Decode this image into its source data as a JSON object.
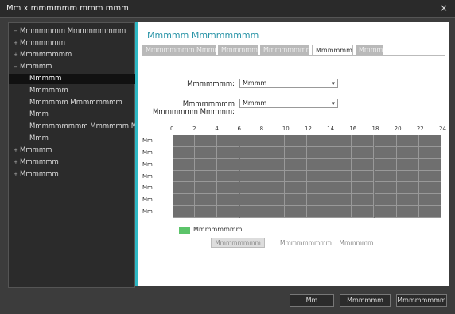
{
  "window": {
    "title": "Mm x mmmmmm mmm mmm",
    "close_glyph": "×"
  },
  "sidebar": {
    "items": [
      {
        "label": "Mmmmmmm Mmmmmmmmm",
        "level": 0,
        "exp": "−",
        "sel": false
      },
      {
        "label": "Mmmmmmm",
        "level": 0,
        "exp": "+",
        "sel": false
      },
      {
        "label": "Mmmmmmmm",
        "level": 0,
        "exp": "+",
        "sel": false
      },
      {
        "label": "Mmmmm",
        "level": 0,
        "exp": "−",
        "sel": false
      },
      {
        "label": "Mmmmm",
        "level": 1,
        "exp": "",
        "sel": true
      },
      {
        "label": "Mmmmmm",
        "level": 1,
        "exp": "",
        "sel": false
      },
      {
        "label": "Mmmmmm Mmmmmmmm",
        "level": 1,
        "exp": "",
        "sel": false
      },
      {
        "label": "Mmm",
        "level": 1,
        "exp": "",
        "sel": false
      },
      {
        "label": "Mmmmmmmmm Mmmmmm Mmmmmm",
        "level": 1,
        "exp": "",
        "sel": false
      },
      {
        "label": "Mmm",
        "level": 1,
        "exp": "",
        "sel": false
      },
      {
        "label": "Mmmmm",
        "level": 0,
        "exp": "+",
        "sel": false
      },
      {
        "label": "Mmmmmm",
        "level": 0,
        "exp": "+",
        "sel": false
      },
      {
        "label": "Mmmmmm",
        "level": 0,
        "exp": "+",
        "sel": false
      }
    ]
  },
  "content": {
    "heading": "Mmmmm Mmmmmmmm",
    "tabs": [
      {
        "label": "Mmmmmmmm Mmmmmm"
      },
      {
        "label": "Mmmmmm"
      },
      {
        "label": "Mmmmmmmm"
      },
      {
        "label": "Mmmmmmmm"
      },
      {
        "label": "Mmmmm"
      }
    ],
    "active_tab": 3,
    "fields": [
      {
        "label": "Mmmmmmm:",
        "value": "Mmmm"
      },
      {
        "label": "Mmmmmmmm Mmmmmmm Mmmmm:",
        "value": "Mmmm"
      }
    ],
    "hours": [
      "0",
      "2",
      "4",
      "6",
      "8",
      "10",
      "12",
      "14",
      "16",
      "18",
      "20",
      "22",
      "24"
    ],
    "days": [
      "Mm",
      "Mm",
      "Mm",
      "Mm",
      "Mm",
      "Mm",
      "Mm"
    ],
    "legend": {
      "label": "Mmmmmmmm",
      "color": "#5cc46a"
    },
    "buttons": [
      {
        "label": "Mmmmmmmm"
      },
      {
        "label": "Mmmmmmmmm"
      },
      {
        "label": "Mmmmmm"
      }
    ]
  },
  "footer": {
    "buttons": [
      {
        "label": "Mm"
      },
      {
        "label": "Mmmmmm"
      },
      {
        "label": "Mmmmmmmm"
      }
    ]
  },
  "colors": {
    "accent": "#2eb8c4",
    "selection_bg": "#111111",
    "grid": "#6f6f6f"
  }
}
